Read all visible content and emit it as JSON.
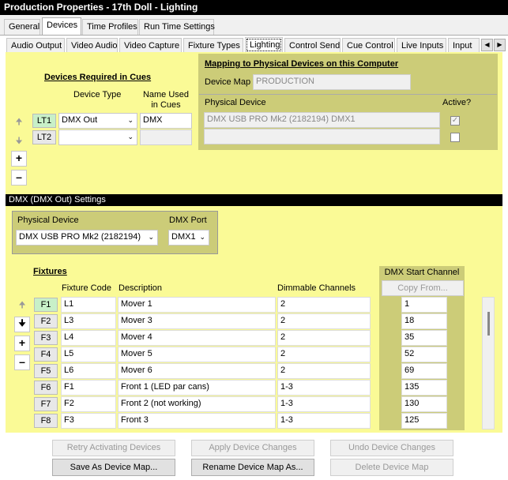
{
  "window": {
    "title": "Production Properties - 17th Doll - Lighting"
  },
  "main_tabs": [
    "General",
    "Devices",
    "Time Profiles",
    "Run Time Settings"
  ],
  "sub_tabs": [
    "Audio Output",
    "Video Audio",
    "Video Capture",
    "Fixture Types",
    "Lighting",
    "Control Send",
    "Cue Control",
    "Live Inputs",
    "Input"
  ],
  "devices_required": {
    "heading": "Devices Required in Cues",
    "col_device_type": "Device Type",
    "col_name_used": "Name Used in Cues",
    "rows": [
      {
        "code": "LT1",
        "device_type": "DMX Out",
        "name": "DMX"
      },
      {
        "code": "LT2",
        "device_type": "",
        "name": ""
      }
    ]
  },
  "mapping": {
    "heading": "Mapping to Physical Devices on this Computer",
    "device_map_label": "Device Map",
    "device_map_value": "PRODUCTION",
    "col_physical": "Physical Device",
    "col_active": "Active?",
    "rows": [
      {
        "device": "DMX USB PRO Mk2 (2182194) DMX1",
        "active": true
      },
      {
        "device": "",
        "active": false
      }
    ]
  },
  "dmx_settings": {
    "heading": "DMX (DMX Out) Settings",
    "physical_label": "Physical Device",
    "physical_value": "DMX USB PRO Mk2 (2182194)",
    "port_label": "DMX Port",
    "port_value": "DMX1"
  },
  "fixtures": {
    "heading": "Fixtures",
    "col_code": "Fixture Code",
    "col_desc": "Description",
    "col_dim": "Dimmable Channels",
    "col_start": "DMX Start Channel",
    "copy_from": "Copy From...",
    "rows": [
      {
        "id": "F1",
        "code": "L1",
        "desc": "Mover 1",
        "dim": "2",
        "start": "1"
      },
      {
        "id": "F2",
        "code": "L3",
        "desc": "Mover 3",
        "dim": "2",
        "start": "18"
      },
      {
        "id": "F3",
        "code": "L4",
        "desc": "Mover 4",
        "dim": "2",
        "start": "35"
      },
      {
        "id": "F4",
        "code": "L5",
        "desc": "Mover 5",
        "dim": "2",
        "start": "52"
      },
      {
        "id": "F5",
        "code": "L6",
        "desc": "Mover 6",
        "dim": "2",
        "start": "69"
      },
      {
        "id": "F6",
        "code": "F1",
        "desc": "Front 1 (LED par cans)",
        "dim": "1-3",
        "start": "135"
      },
      {
        "id": "F7",
        "code": "F2",
        "desc": "Front 2 (not working)",
        "dim": "1-3",
        "start": "130"
      },
      {
        "id": "F8",
        "code": "F3",
        "desc": "Front 3",
        "dim": "1-3",
        "start": "125"
      }
    ]
  },
  "buttons": {
    "retry": "Retry Activating Devices",
    "apply": "Apply Device Changes",
    "undo": "Undo Device Changes",
    "save_map": "Save As Device Map...",
    "rename_map": "Rename Device Map As...",
    "delete_map": "Delete Device Map"
  },
  "colors": {
    "panel": "#fafa96",
    "olive": "#cccc78",
    "header": "#000000"
  }
}
